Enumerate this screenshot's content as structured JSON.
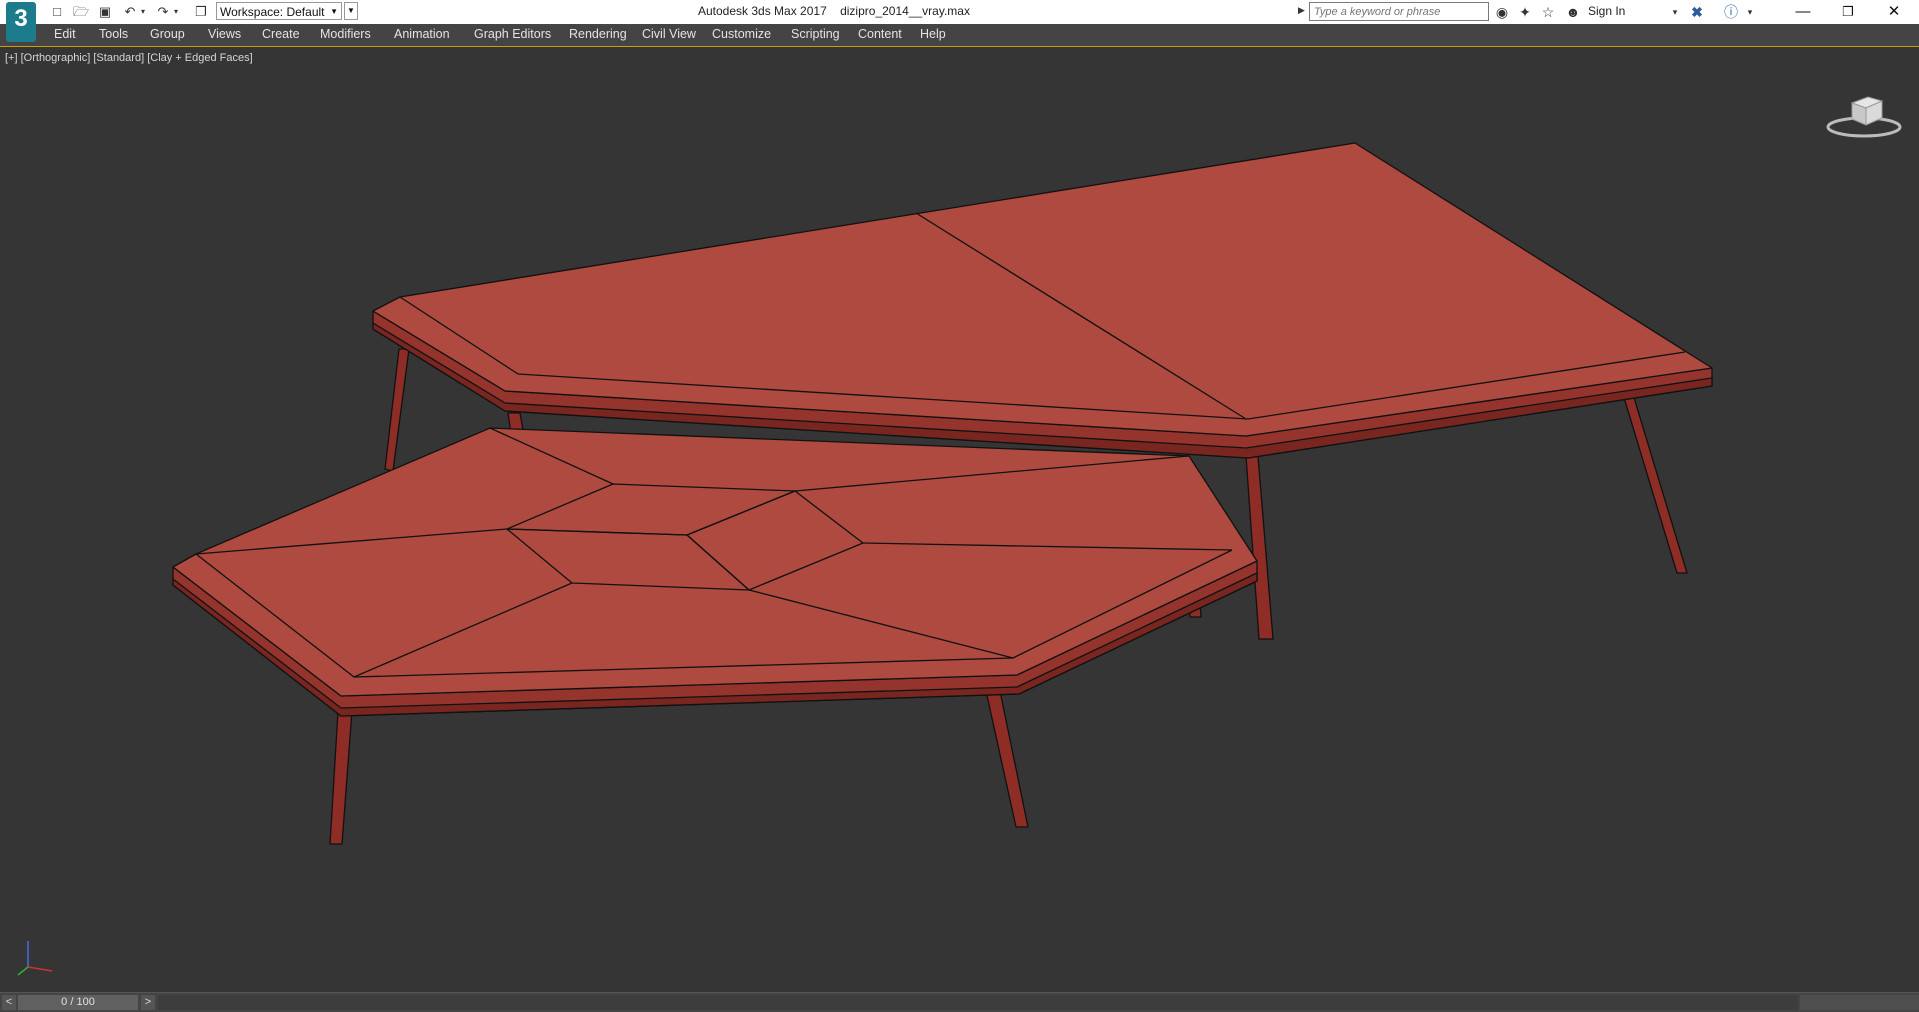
{
  "titlebar": {
    "logo_text": "3",
    "workspace": "Workspace: Default",
    "app_title": "Autodesk 3ds Max 2017",
    "file_name": "dizipro_2014__vray.max",
    "search_placeholder": "Type a keyword or phrase",
    "sign_in": "Sign In",
    "icons": [
      "new-file-icon",
      "open-file-icon",
      "save-icon",
      "undo-icon",
      "redo-icon",
      "project-folder-icon",
      "binoculars-icon",
      "satellite-icon",
      "star-icon",
      "user-icon",
      "exchange-icon",
      "help-icon"
    ],
    "window_controls": [
      "minimize",
      "maximize",
      "close"
    ]
  },
  "menu": {
    "items": [
      "Edit",
      "Tools",
      "Group",
      "Views",
      "Create",
      "Modifiers",
      "Animation",
      "Graph Editors",
      "Rendering",
      "Civil View",
      "Customize",
      "Scripting",
      "Content",
      "Help"
    ]
  },
  "viewport": {
    "label_plus": "[+]",
    "label_view": "[Orthographic]",
    "label_shading_std": "[Standard]",
    "label_shading": "[Clay + Edged Faces]",
    "model_color": "#af4a40",
    "background_color": "#353535"
  },
  "timeline": {
    "frame": "0 / 100",
    "prev": "<",
    "next": ">"
  }
}
